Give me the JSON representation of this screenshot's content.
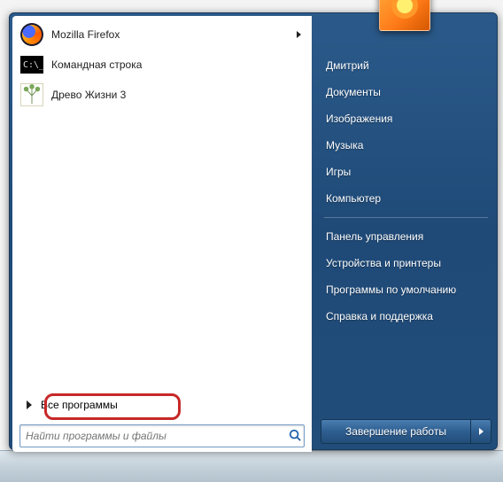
{
  "left": {
    "programs": [
      {
        "name": "Mozilla Firefox",
        "has_submenu": true,
        "icon": "firefox"
      },
      {
        "name": "Командная строка",
        "has_submenu": false,
        "icon": "cmd"
      },
      {
        "name": "Древо Жизни 3",
        "has_submenu": false,
        "icon": "tree"
      }
    ],
    "all_programs_label": "Все программы",
    "search_placeholder": "Найти программы и файлы"
  },
  "right": {
    "items_top": [
      "Дмитрий",
      "Документы",
      "Изображения",
      "Музыка",
      "Игры",
      "Компьютер"
    ],
    "items_bottom": [
      "Панель управления",
      "Устройства и принтеры",
      "Программы по умолчанию",
      "Справка и поддержка"
    ],
    "shutdown_label": "Завершение работы"
  },
  "colors": {
    "highlight_border": "#c72828",
    "panel_bg_start": "#2b5a8a",
    "panel_bg_end": "#214d7a"
  }
}
